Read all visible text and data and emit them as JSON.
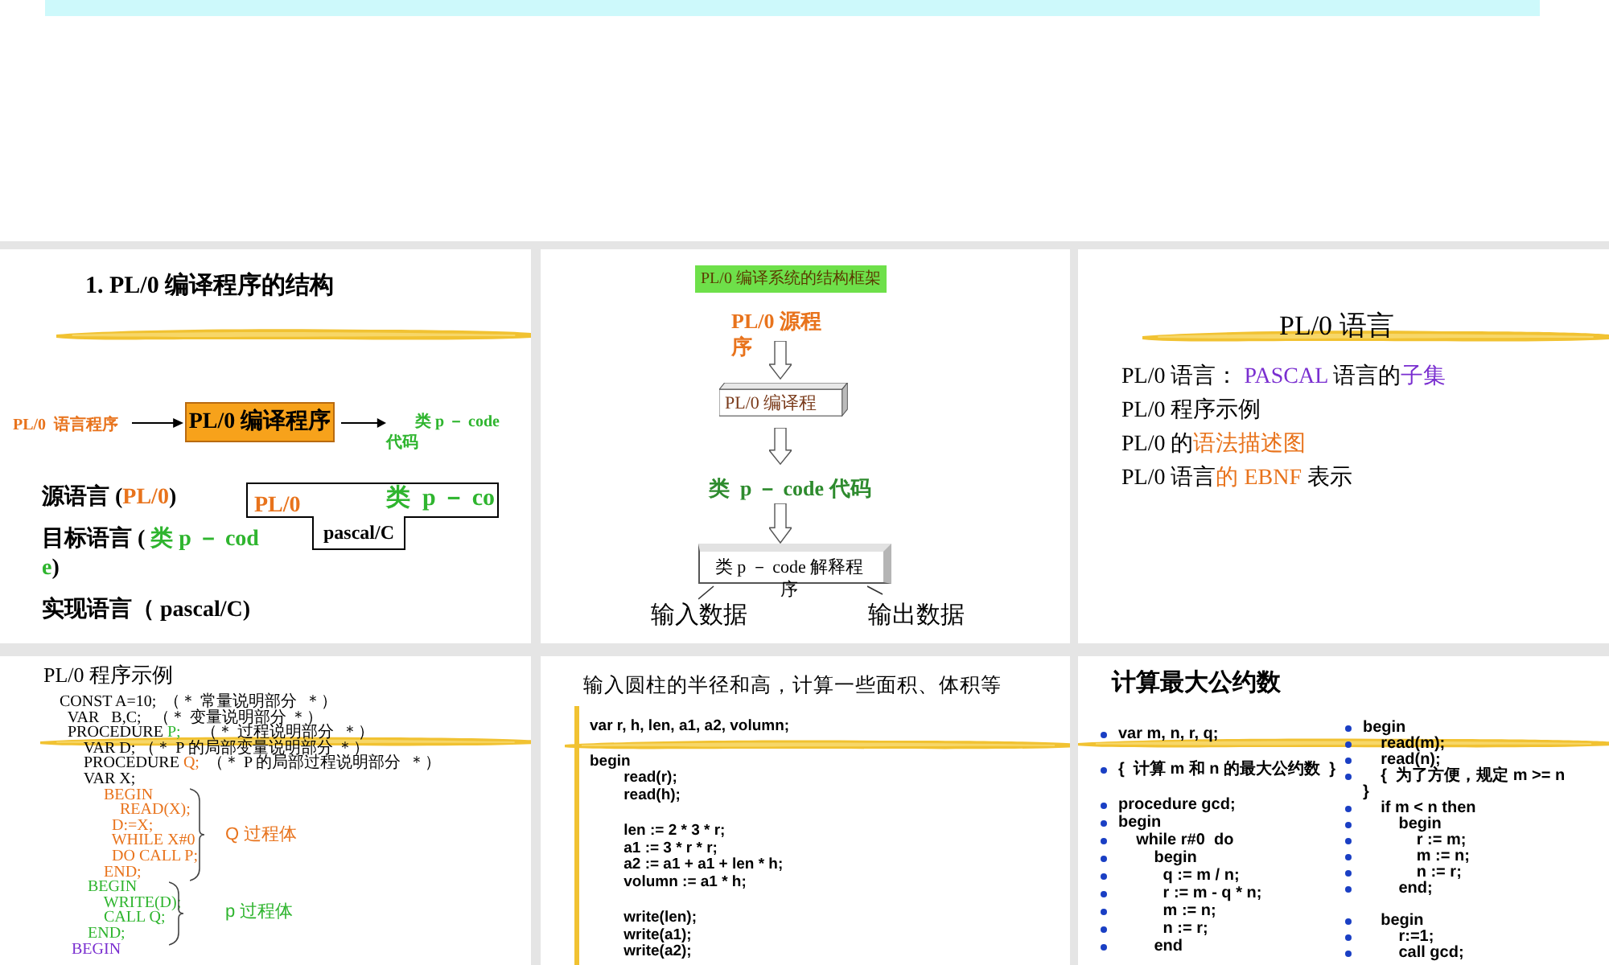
{
  "slides": [
    {
      "kind": "structure",
      "title": "1. PL/0 编译程序的结构",
      "flow": {
        "input": "PL/0  语言程序",
        "box": "PL/0 编译程序",
        "output": "类  p － code 代码"
      },
      "terms": [
        [
          {
            "text": "源语言 ("
          },
          {
            "text": "PL/0",
            "color": "#e8731c"
          },
          {
            "text": ")"
          }
        ],
        [
          {
            "text": "目标语言 ( "
          },
          {
            "text": "类  p － code",
            "color": "#2fb52f"
          },
          {
            "text": ")"
          }
        ],
        [
          {
            "text": "实现语言（ pascal/C)"
          }
        ]
      ],
      "t_diagram": {
        "top_left": "PL/0",
        "top_right": "类  p － co",
        "bottom": "pascal/C"
      }
    },
    {
      "kind": "framework",
      "header": "PL/0 编译系统的结构框架",
      "source": "PL/0 源程序",
      "compiler": "PL/0 编译程",
      "pcode": "类  p － code 代码",
      "interpreter": "类  p － code 解释程序",
      "input": "输入数据",
      "output": "输出数据"
    },
    {
      "kind": "outline",
      "title": "PL/0 语言",
      "items": [
        [
          {
            "text": "PL/0 语言： "
          },
          {
            "text": "PASCAL",
            "color": "#7a2fd0"
          },
          {
            "text": " 语言的"
          },
          {
            "text": "子集",
            "color": "#7a2fd0"
          }
        ],
        [
          {
            "text": "PL/0 程序示例"
          }
        ],
        [
          {
            "text": "PL/0 的"
          },
          {
            "text": "语法描述图",
            "color": "#e8731c"
          }
        ],
        [
          {
            "text": "PL/0 语言"
          },
          {
            "text": "的 EBNF",
            "color": "#e8731c"
          },
          {
            "text": " 表示"
          }
        ]
      ]
    },
    {
      "kind": "example",
      "title": "PL/0 程序示例",
      "code": [
        [
          {
            "text": "  CONST A=10;  （＊ 常量说明部分  ＊）"
          }
        ],
        [
          {
            "text": "    VAR   B,C;   （＊ 变量说明部分 ＊）"
          }
        ],
        [
          {
            "text": "    PROCEDURE "
          },
          {
            "text": "P;",
            "color": "#2fb52f"
          },
          {
            "text": "     （＊ 过程说明部分  ＊）"
          }
        ],
        [
          {
            "text": "        VAR D; （＊ P 的局部变量说明部分 ＊）"
          }
        ],
        [
          {
            "text": "        PROCEDURE "
          },
          {
            "text": "Q;",
            "color": "#e8731c"
          },
          {
            "text": "  （＊ P 的局部过程说明部分  ＊）"
          }
        ],
        [
          {
            "text": "        VAR X;"
          }
        ],
        [
          {
            "text": "             BEGIN",
            "color": "#e8731c"
          }
        ],
        [
          {
            "text": "                 READ(X);",
            "color": "#e8731c"
          }
        ],
        [
          {
            "text": "               D:=X;",
            "color": "#e8731c"
          }
        ],
        [
          {
            "text": "               WHILE X#0",
            "color": "#e8731c"
          }
        ],
        [
          {
            "text": "               DO CALL P;",
            "color": "#e8731c"
          }
        ],
        [
          {
            "text": "             END;",
            "color": "#e8731c"
          }
        ],
        [
          {
            "text": "         BEGIN",
            "color": "#2fb52f"
          }
        ],
        [
          {
            "text": "             WRITE(D);",
            "color": "#2fb52f"
          }
        ],
        [
          {
            "text": "             CALL Q;",
            "color": "#2fb52f"
          }
        ],
        [
          {
            "text": "         END;",
            "color": "#2fb52f"
          }
        ],
        [
          {
            "text": "     BEGIN",
            "color": "#7a2fd0"
          }
        ]
      ],
      "braces": [
        {
          "label": "Q 过程体",
          "color": "#e8731c"
        },
        {
          "label": "p 过程体",
          "color": "#2fb52f"
        }
      ]
    },
    {
      "kind": "listing",
      "title": "输入圆柱的半径和高，计算一些面积、体积等",
      "lines": [
        {
          "kind": "line",
          "text": "var r, h, len, a1, a2, volumn;"
        },
        {
          "kind": "space"
        },
        {
          "kind": "line",
          "text": "begin"
        },
        {
          "kind": "line",
          "text": "        read(r);"
        },
        {
          "kind": "line",
          "text": "        read(h);"
        },
        {
          "kind": "space"
        },
        {
          "kind": "line",
          "text": "        len := 2 * 3 * r;"
        },
        {
          "kind": "line",
          "text": "        a1 := 3 * r * r;"
        },
        {
          "kind": "line",
          "text": "        a2 := a1 + a1 + len * h;"
        },
        {
          "kind": "line",
          "text": "        volumn := a1 * h;"
        },
        {
          "kind": "space"
        },
        {
          "kind": "line",
          "text": "        write(len);"
        },
        {
          "kind": "line",
          "text": "        write(a1);"
        },
        {
          "kind": "line",
          "text": "        write(a2);"
        }
      ]
    },
    {
      "kind": "bullets",
      "title": "计算最大公约数",
      "columns": [
        [
          {
            "kind": "line",
            "bullet": true,
            "text": "var m, n, r, q;"
          },
          {
            "kind": "space"
          },
          {
            "kind": "line",
            "bullet": true,
            "text": "{  计算 m 和 n 的最大公约数  }"
          },
          {
            "kind": "space"
          },
          {
            "kind": "line",
            "bullet": true,
            "text": "procedure gcd;"
          },
          {
            "kind": "line",
            "bullet": true,
            "text": "begin"
          },
          {
            "kind": "line",
            "bullet": true,
            "text": "    while r#0  do"
          },
          {
            "kind": "line",
            "bullet": true,
            "text": "        begin"
          },
          {
            "kind": "line",
            "bullet": true,
            "text": "          q := m / n;"
          },
          {
            "kind": "line",
            "bullet": true,
            "text": "          r := m - q * n;"
          },
          {
            "kind": "line",
            "bullet": true,
            "text": "          m := n;"
          },
          {
            "kind": "line",
            "bullet": true,
            "text": "          n := r;"
          },
          {
            "kind": "line",
            "bullet": true,
            "text": "        end"
          }
        ],
        [
          {
            "kind": "line",
            "bullet": true,
            "text": "begin"
          },
          {
            "kind": "line",
            "bullet": true,
            "text": "    read(m);"
          },
          {
            "kind": "line",
            "bullet": true,
            "text": "    read(n);"
          },
          {
            "kind": "line",
            "bullet": true,
            "text": "    {  为了方便，规定 m >= n"
          },
          {
            "kind": "line",
            "bullet": false,
            "text": "}"
          },
          {
            "kind": "line",
            "bullet": true,
            "text": "    if m < n then"
          },
          {
            "kind": "line",
            "bullet": true,
            "text": "        begin"
          },
          {
            "kind": "line",
            "bullet": true,
            "text": "            r := m;"
          },
          {
            "kind": "line",
            "bullet": true,
            "text": "            m := n;"
          },
          {
            "kind": "line",
            "bullet": true,
            "text": "            n := r;"
          },
          {
            "kind": "line",
            "bullet": true,
            "text": "        end;"
          },
          {
            "kind": "space"
          },
          {
            "kind": "line",
            "bullet": true,
            "text": "    begin"
          },
          {
            "kind": "line",
            "bullet": true,
            "text": "        r:=1;"
          },
          {
            "kind": "line",
            "bullet": true,
            "text": "        call gcd;"
          }
        ]
      ]
    }
  ]
}
